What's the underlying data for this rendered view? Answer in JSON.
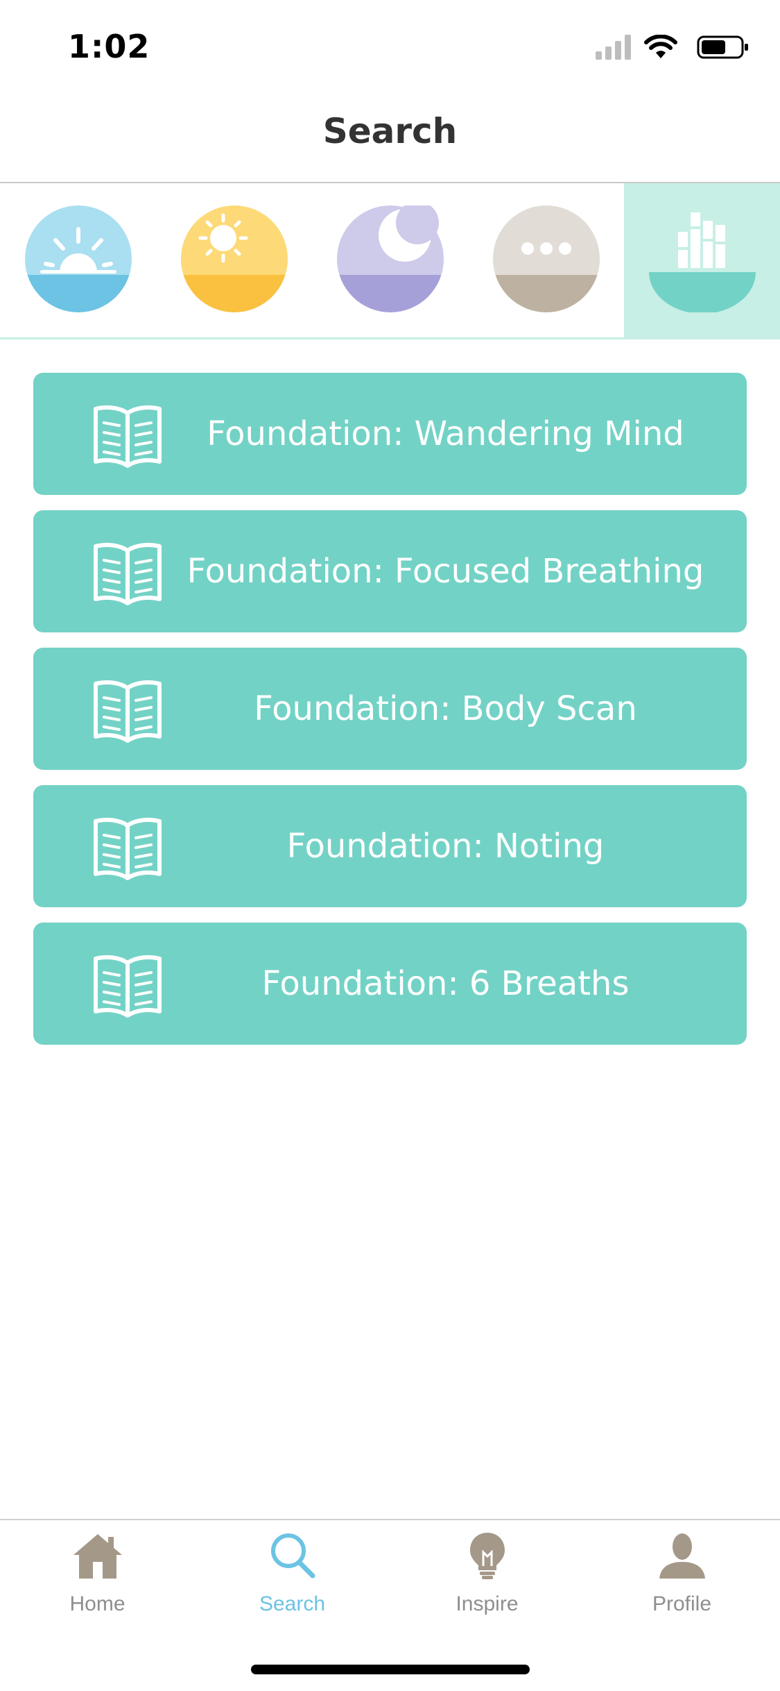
{
  "status_bar": {
    "time": "1:02"
  },
  "header": {
    "title": "Search"
  },
  "categories": [
    {
      "name": "morning",
      "icon": "sunrise-icon",
      "top_color": "#a9dff0",
      "bottom_color": "#6cc3e3"
    },
    {
      "name": "day",
      "icon": "sun-icon",
      "top_color": "#fdd977",
      "bottom_color": "#f9c13f"
    },
    {
      "name": "night",
      "icon": "moon-icon",
      "top_color": "#cdcaea",
      "bottom_color": "#a5a1d8"
    },
    {
      "name": "more",
      "icon": "more-dots-icon",
      "top_color": "#e1ddd6",
      "bottom_color": "#bdb2a2"
    },
    {
      "name": "library",
      "icon": "library-icon",
      "selected": true,
      "bottom_color": "#73d2c6"
    }
  ],
  "list": {
    "items": [
      {
        "label": "Foundation: Wandering Mind"
      },
      {
        "label": "Foundation: Focused Breathing"
      },
      {
        "label": "Foundation: Body Scan"
      },
      {
        "label": "Foundation: Noting"
      },
      {
        "label": "Foundation: 6 Breaths"
      }
    ],
    "item_color": "#73d2c6"
  },
  "tab_bar": {
    "tabs": [
      {
        "label": "Home",
        "icon": "home-icon"
      },
      {
        "label": "Search",
        "icon": "search-icon",
        "active": true
      },
      {
        "label": "Inspire",
        "icon": "lightbulb-icon"
      },
      {
        "label": "Profile",
        "icon": "profile-icon"
      }
    ],
    "active_color": "#6cc3e3",
    "inactive_color": "#8e8e8e"
  }
}
